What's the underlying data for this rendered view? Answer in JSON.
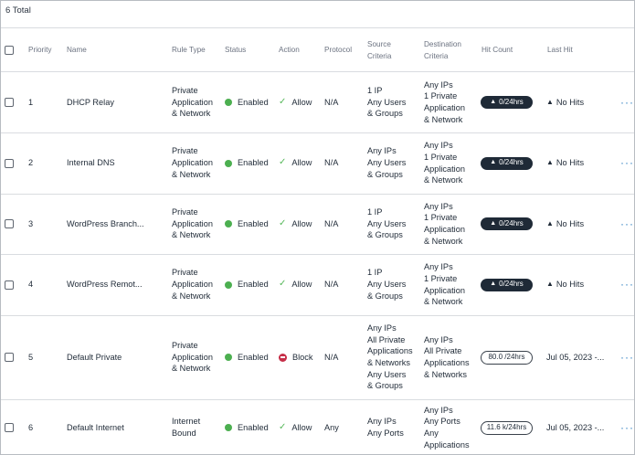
{
  "header": {
    "total_label": "6 Total"
  },
  "columns": {
    "priority": "Priority",
    "name": "Name",
    "rule_type": "Rule Type",
    "status": "Status",
    "action": "Action",
    "protocol": "Protocol",
    "source": "Source\nCriteria",
    "destination": "Destination\nCriteria",
    "hit_count": "Hit Count",
    "last_hit": "Last Hit"
  },
  "icons": {
    "more": "more-horizontal-icon",
    "check": "check-icon",
    "block": "block-icon",
    "warning": "warning-triangle-icon",
    "status": "status-dot-icon"
  },
  "colors": {
    "enabled": "#4caf50",
    "allow": "#57b85b",
    "block": "#c62e48",
    "link": "#2f7fc1",
    "pill_dark": "#1f2a37"
  },
  "rows": [
    {
      "priority": "1",
      "name": "DHCP Relay",
      "rule_type": "Private\nApplication\n& Network",
      "status": "Enabled",
      "action": "Allow",
      "action_kind": "allow",
      "protocol": "N/A",
      "source": "1 IP\nAny Users\n& Groups",
      "destination": "Any IPs\n1 Private\nApplication\n& Network",
      "hit_count": "0/24hrs",
      "hit_style": "dark",
      "last_hit": "No Hits",
      "last_hit_icon": true,
      "more": "···"
    },
    {
      "priority": "2",
      "name": "Internal DNS",
      "rule_type": "Private\nApplication\n& Network",
      "status": "Enabled",
      "action": "Allow",
      "action_kind": "allow",
      "protocol": "N/A",
      "source": "Any IPs\nAny Users\n& Groups",
      "destination": "Any IPs\n1 Private\nApplication\n& Network",
      "hit_count": "0/24hrs",
      "hit_style": "dark",
      "last_hit": "No Hits",
      "last_hit_icon": true,
      "more": "···"
    },
    {
      "priority": "3",
      "name": "WordPress Branch...",
      "rule_type": "Private\nApplication\n& Network",
      "status": "Enabled",
      "action": "Allow",
      "action_kind": "allow",
      "protocol": "N/A",
      "source": "1 IP\nAny Users\n& Groups",
      "destination": "Any IPs\n1 Private\nApplication\n& Network",
      "hit_count": "0/24hrs",
      "hit_style": "dark",
      "last_hit": "No Hits",
      "last_hit_icon": true,
      "more": "···"
    },
    {
      "priority": "4",
      "name": "WordPress Remot...",
      "rule_type": "Private\nApplication\n& Network",
      "status": "Enabled",
      "action": "Allow",
      "action_kind": "allow",
      "protocol": "N/A",
      "source": "1 IP\nAny Users\n& Groups",
      "destination": "Any IPs\n1 Private\nApplication\n& Network",
      "hit_count": "0/24hrs",
      "hit_style": "dark",
      "last_hit": "No Hits",
      "last_hit_icon": true,
      "more": "···"
    },
    {
      "priority": "5",
      "name": "Default Private",
      "rule_type": "Private\nApplication\n& Network",
      "status": "Enabled",
      "action": "Block",
      "action_kind": "block",
      "protocol": "N/A",
      "source": "Any IPs\nAll Private\nApplications\n& Networks\nAny Users\n& Groups",
      "destination": "Any IPs\nAll Private\nApplications\n& Networks",
      "hit_count": "80.0 /24hrs",
      "hit_style": "light",
      "last_hit": "Jul 05, 2023 -...",
      "last_hit_icon": false,
      "more": "···"
    },
    {
      "priority": "6",
      "name": "Default Internet",
      "rule_type": "Internet\nBound",
      "status": "Enabled",
      "action": "Allow",
      "action_kind": "allow",
      "protocol": "Any",
      "source": "Any IPs\nAny Ports",
      "destination": "Any IPs\nAny Ports\nAny\nApplications",
      "hit_count": "11.6 k/24hrs",
      "hit_style": "light",
      "last_hit": "Jul 05, 2023 -...",
      "last_hit_icon": false,
      "more": "···"
    }
  ]
}
